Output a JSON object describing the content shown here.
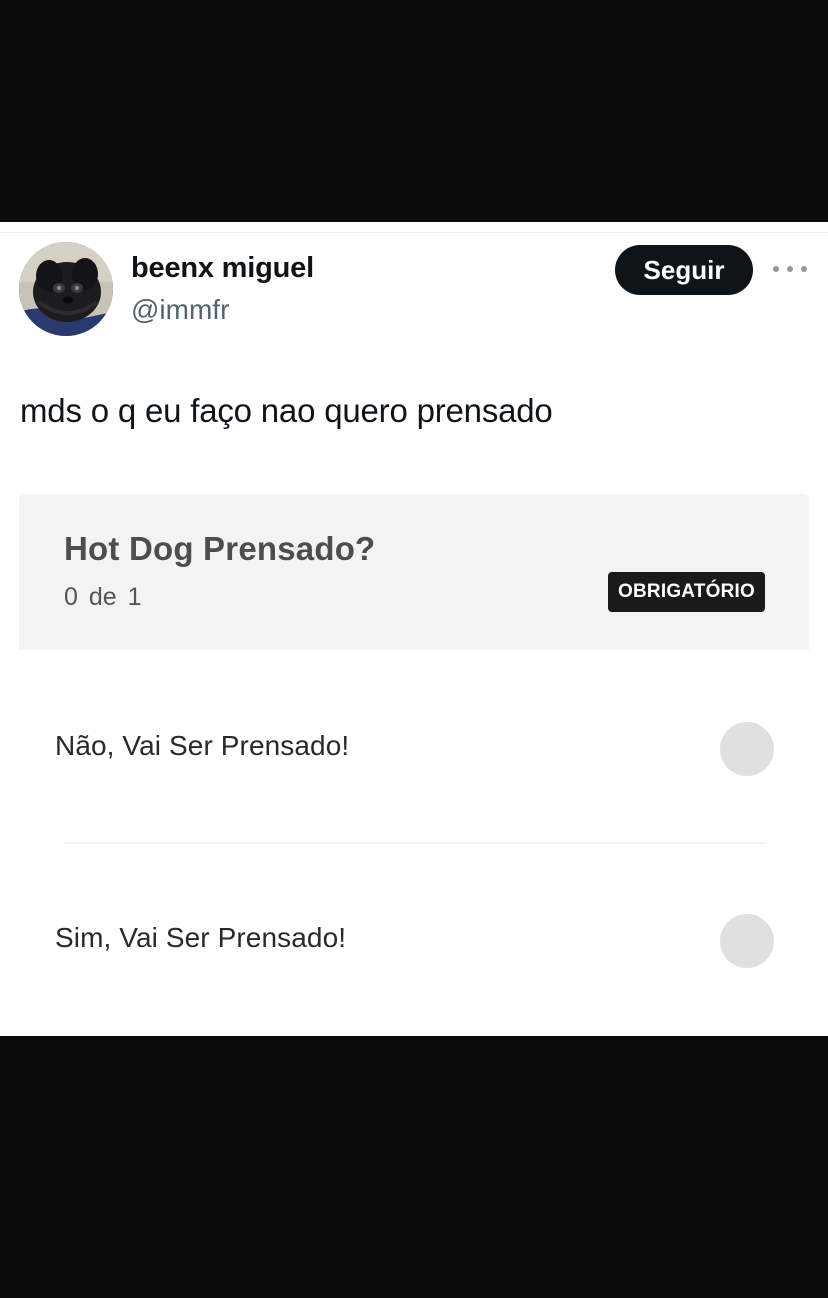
{
  "tweet": {
    "author": {
      "display_name": "beenx miguel",
      "handle": "@immfr"
    },
    "follow_label": "Seguir",
    "text": "mds o q eu faço nao quero prensado"
  },
  "form": {
    "question": {
      "title": "Hot Dog Prensado?",
      "count": "0 de 1",
      "badge": "OBRIGATÓRIO"
    },
    "options": [
      {
        "label": "Não, Vai Ser Prensado!",
        "selected": false
      },
      {
        "label": "Sim, Vai Ser Prensado!",
        "selected": false
      }
    ]
  },
  "icons": {
    "more": "more-horizontal-icon",
    "avatar": "avatar-dog-photo"
  },
  "colors": {
    "follow_button": "#0f1419",
    "handle_text": "#536471",
    "question_background": "#f3f3f3",
    "badge_background": "#1a1a1a",
    "radio_unselected": "#e0e0e0",
    "frame_background": "#0b0b0b"
  }
}
